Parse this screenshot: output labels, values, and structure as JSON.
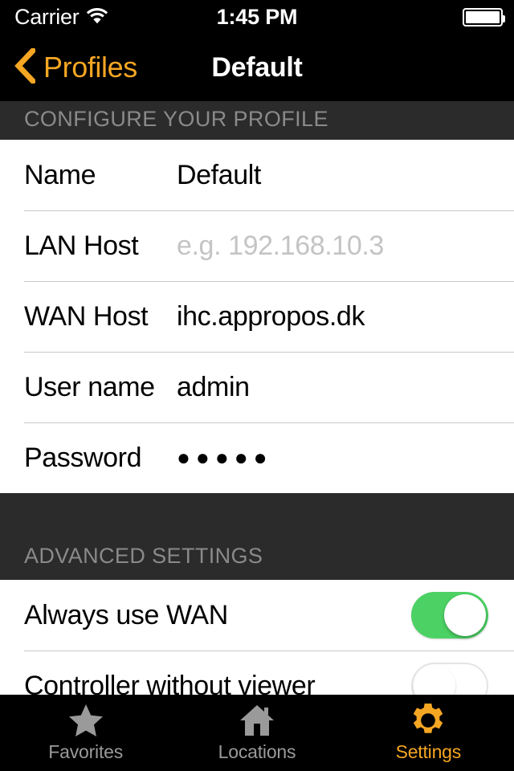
{
  "status_bar": {
    "carrier": "Carrier",
    "wifi_icon": "wifi-icon",
    "time": "1:45 PM",
    "battery_icon": "battery-full-icon"
  },
  "nav_bar": {
    "back_icon": "chevron-left-icon",
    "back_label": "Profiles",
    "title": "Default"
  },
  "sections": [
    {
      "header": "CONFIGURE YOUR PROFILE",
      "rows": [
        {
          "label": "Name",
          "value": "Default",
          "placeholder": ""
        },
        {
          "label": "LAN Host",
          "value": "",
          "placeholder": "e.g. 192.168.10.3"
        },
        {
          "label": "WAN Host",
          "value": "ihc.appropos.dk",
          "placeholder": ""
        },
        {
          "label": "User name",
          "value": "admin",
          "placeholder": ""
        },
        {
          "label": "Password",
          "value": "●●●●●",
          "placeholder": ""
        }
      ]
    },
    {
      "header": "ADVANCED SETTINGS",
      "rows": [
        {
          "label": "Always use WAN",
          "toggle": "on"
        },
        {
          "label": "Controller without viewer",
          "toggle": "off"
        }
      ]
    }
  ],
  "tab_bar": {
    "items": [
      {
        "label": "Favorites",
        "icon": "star-icon",
        "active": false
      },
      {
        "label": "Locations",
        "icon": "house-icon",
        "active": false
      },
      {
        "label": "Settings",
        "icon": "gear-icon",
        "active": true
      }
    ]
  },
  "colors": {
    "accent": "#F5A623",
    "switch_on": "#4CD264",
    "section_header_bg": "#2B2B2B",
    "section_header_text": "#8A8A8A",
    "placeholder_text": "#C4C4C4",
    "separator": "#C8C7CC",
    "bar_background": "#000000"
  }
}
